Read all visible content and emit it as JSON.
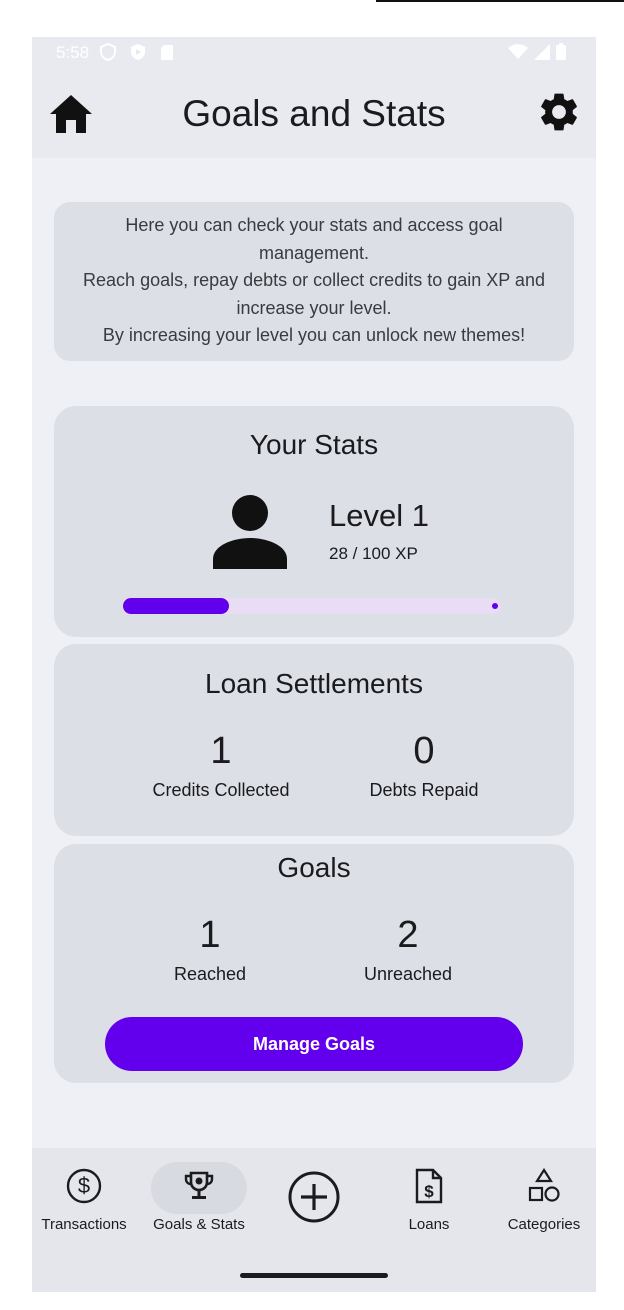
{
  "status_bar": {
    "time": "5:58",
    "icons": [
      "shield-outline-icon",
      "shield-play-icon",
      "sd-card-icon",
      "wifi-icon",
      "signal-icon",
      "battery-icon"
    ]
  },
  "header": {
    "title": "Goals and Stats",
    "home_icon": "home-icon",
    "settings_icon": "settings-gear-icon"
  },
  "info": {
    "lines": [
      "Here you can check your stats and access goal management.",
      "Reach goals, repay debts or collect credits to gain XP and increase your level.",
      "By increasing your level you can unlock new themes!"
    ]
  },
  "stats": {
    "title": "Your Stats",
    "level": "Level 1",
    "xp": "28 / 100 XP",
    "xp_progress": 0.28,
    "avatar_icon": "person-icon"
  },
  "loans": {
    "title": "Loan Settlements",
    "credits_value": "1",
    "credits_label": "Credits Collected",
    "debts_value": "0",
    "debts_label": "Debts Repaid"
  },
  "goals": {
    "title": "Goals",
    "reached_value": "1",
    "reached_label": "Reached",
    "unreached_value": "2",
    "unreached_label": "Unreached",
    "manage_button": "Manage Goals"
  },
  "bottom_nav": {
    "items": [
      {
        "label": "Transactions",
        "icon": "dollar-circle-icon"
      },
      {
        "label": "Goals & Stats",
        "icon": "trophy-icon",
        "active": true
      },
      {
        "label": "",
        "icon": "add-circle-icon"
      },
      {
        "label": "Loans",
        "icon": "invoice-dollar-icon"
      },
      {
        "label": "Categories",
        "icon": "shapes-icon"
      }
    ]
  },
  "colors": {
    "accent": "#6200ee",
    "progress_track": "#e8ddf5",
    "card": "#dcdfe5",
    "background": "#eef0f5"
  }
}
